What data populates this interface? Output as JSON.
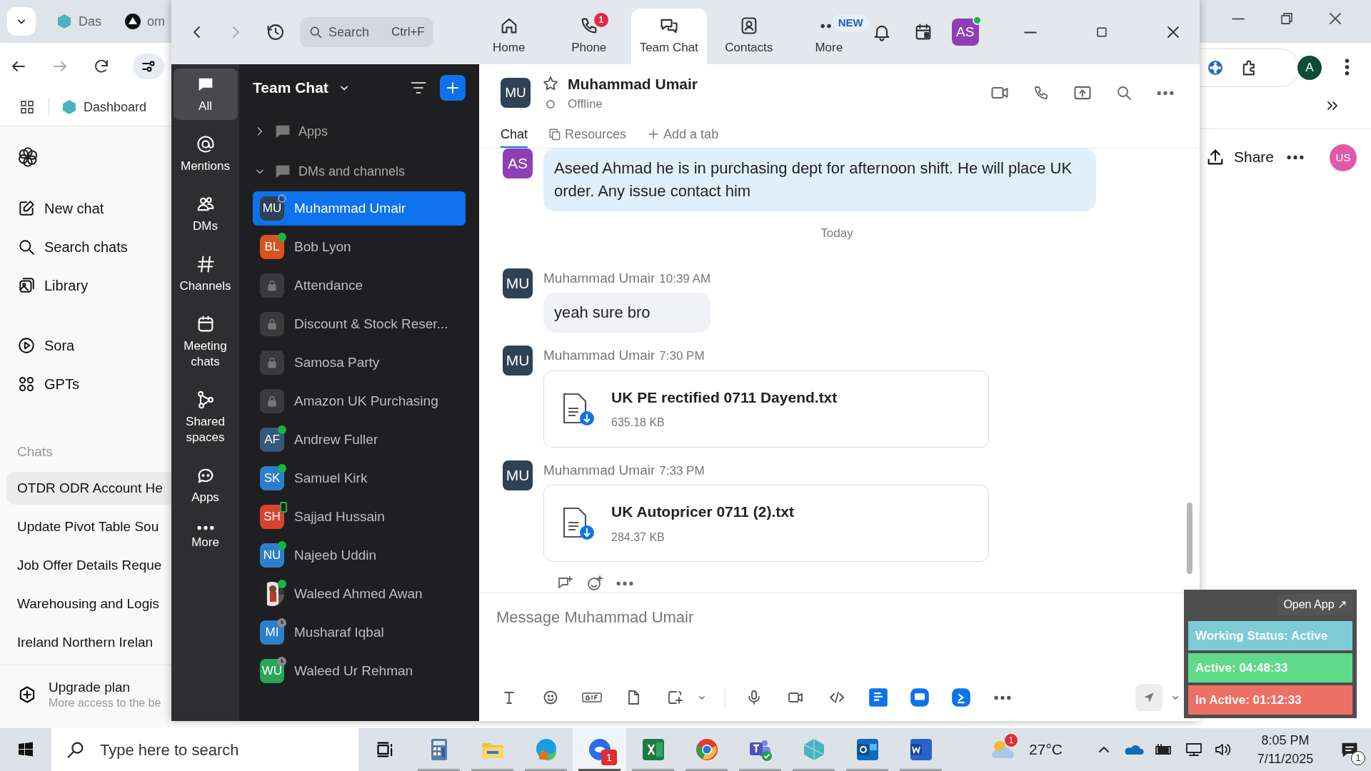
{
  "browser": {
    "tabs": [
      {
        "label": "Das",
        "selected": false
      },
      {
        "label": "om",
        "selected": false
      }
    ],
    "bookmark": "Dashboard",
    "profile": "A",
    "share": "Share",
    "user_badge": "US",
    "sidebar": {
      "items": [
        "New chat",
        "Search chats",
        "Library",
        "Sora",
        "GPTs"
      ],
      "chats_heading": "Chats",
      "chats": [
        {
          "label": "OTDR ODR Account He",
          "selected": true
        },
        {
          "label": "Update Pivot Table Sou",
          "selected": false
        },
        {
          "label": "Job Offer Details Reque",
          "selected": false
        },
        {
          "label": "Warehousing and Logis",
          "selected": false
        },
        {
          "label": "Ireland Northern Irelan",
          "selected": false
        }
      ],
      "upgrade": {
        "title": "Upgrade plan",
        "subtitle": "More access to the be"
      }
    }
  },
  "zoom": {
    "search": {
      "placeholder": "Search",
      "shortcut": "Ctrl+F"
    },
    "nav_tabs": [
      {
        "label": "Home",
        "selected": false
      },
      {
        "label": "Phone",
        "selected": false,
        "badge": "1"
      },
      {
        "label": "Team Chat",
        "selected": true
      },
      {
        "label": "Contacts",
        "selected": false
      },
      {
        "label": "More",
        "selected": false,
        "tag": "NEW"
      }
    ],
    "avatar": {
      "initials": "AS",
      "color": "#8e3fb5"
    },
    "rail": [
      {
        "label": "All",
        "selected": true
      },
      {
        "label": "Mentions",
        "selected": false
      },
      {
        "label": "DMs",
        "selected": false
      },
      {
        "label": "Channels",
        "selected": false
      },
      {
        "label": "Meeting chats",
        "selected": false
      },
      {
        "label": "Shared spaces",
        "selected": false
      },
      {
        "label": "Apps",
        "selected": false
      },
      {
        "label": "More",
        "selected": false
      }
    ],
    "list": {
      "title": "Team Chat",
      "sections": [
        {
          "label": "Apps",
          "expanded": false
        },
        {
          "label": "DMs and channels",
          "expanded": true
        }
      ],
      "items": [
        {
          "name": "Muhammad Umair",
          "kind": "person",
          "initials": "MU",
          "color": "#2f4154",
          "online": false,
          "away": false,
          "on_mobile": false,
          "selected": true
        },
        {
          "name": "Bob Lyon",
          "kind": "person",
          "initials": "BL",
          "color": "#d9531e",
          "online": true,
          "away": false,
          "on_mobile": false,
          "selected": false
        },
        {
          "name": "Attendance",
          "kind": "channel",
          "selected": false
        },
        {
          "name": "Discount & Stock Reser...",
          "kind": "channel",
          "selected": false
        },
        {
          "name": "Samosa Party",
          "kind": "channel",
          "selected": false
        },
        {
          "name": "Amazon UK Purchasing",
          "kind": "channel",
          "selected": false
        },
        {
          "name": "Andrew Fuller",
          "kind": "person",
          "initials": "AF",
          "color": "#35587c",
          "online": true,
          "away": false,
          "on_mobile": false,
          "selected": false
        },
        {
          "name": "Samuel Kirk",
          "kind": "person",
          "initials": "SK",
          "color": "#2d7fc9",
          "online": true,
          "away": false,
          "on_mobile": false,
          "selected": false
        },
        {
          "name": "Sajjad Hussain",
          "kind": "person",
          "initials": "SH",
          "color": "#d8432e",
          "online": false,
          "away": false,
          "on_mobile": true,
          "selected": false
        },
        {
          "name": "Najeeb Uddin",
          "kind": "person",
          "initials": "NU",
          "color": "#2d7fc9",
          "online": true,
          "away": false,
          "on_mobile": false,
          "selected": false
        },
        {
          "name": "Waleed Ahmed Awan",
          "kind": "picture",
          "online": true,
          "away": false,
          "on_mobile": false,
          "selected": false
        },
        {
          "name": "Musharaf Iqbal",
          "kind": "person",
          "initials": "MI",
          "color": "#2d7fc9",
          "online": false,
          "away": true,
          "on_mobile": false,
          "selected": false
        },
        {
          "name": "Waleed Ur Rehman",
          "kind": "person",
          "initials": "WU",
          "color": "#2aa55a",
          "online": false,
          "away": true,
          "on_mobile": false,
          "selected": false
        }
      ]
    },
    "chat": {
      "contact_initials": "MU",
      "contact": "Muhammad Umair",
      "status": "Offline",
      "tabs": [
        {
          "label": "Chat",
          "selected": true
        },
        {
          "label": "Resources",
          "selected": false
        },
        {
          "label": "Add a tab",
          "selected": false
        }
      ],
      "messages": [
        {
          "kind": "text",
          "avatar": "AS",
          "color": "#8e3fb5",
          "mine": true,
          "text": "Aseed Ahmad he is in purchasing dept for afternoon shift. He will place UK order. Any issue contact him"
        },
        {
          "kind": "divider",
          "text": "Today"
        },
        {
          "kind": "text",
          "avatar": "MU",
          "color": "#2f4154",
          "mine": false,
          "sender": "Muhammad Umair",
          "time": "10:39 AM",
          "text": "yeah sure bro"
        },
        {
          "kind": "file",
          "avatar": "MU",
          "color": "#2f4154",
          "sender": "Muhammad Umair",
          "time": "7:30 PM",
          "file": "UK PE rectified 0711 Dayend.txt",
          "size": "635.18 KB"
        },
        {
          "kind": "file",
          "avatar": "MU",
          "color": "#2f4154",
          "sender": "Muhammad Umair",
          "time": "7:33 PM",
          "file": "UK Autopricer 0711 (2).txt",
          "size": "284.37 KB"
        }
      ],
      "composer": {
        "placeholder": "Message Muhammad Umair"
      }
    }
  },
  "status_widget": {
    "open_app": "Open App ↗",
    "rows": [
      {
        "label": "Working Status: Active",
        "color": "#7ccbd6"
      },
      {
        "label": "Active: 04:48:33",
        "color": "#5fd98a"
      },
      {
        "label": "In Active: 01:12:33",
        "color": "#ec7063"
      }
    ]
  },
  "taskbar": {
    "search_placeholder": "Type here to search",
    "zoom_badge": "1",
    "weather_badge": "1",
    "temperature": "27°C",
    "time": "8:05 PM",
    "date": "7/11/2025",
    "notification_badge": "1"
  }
}
